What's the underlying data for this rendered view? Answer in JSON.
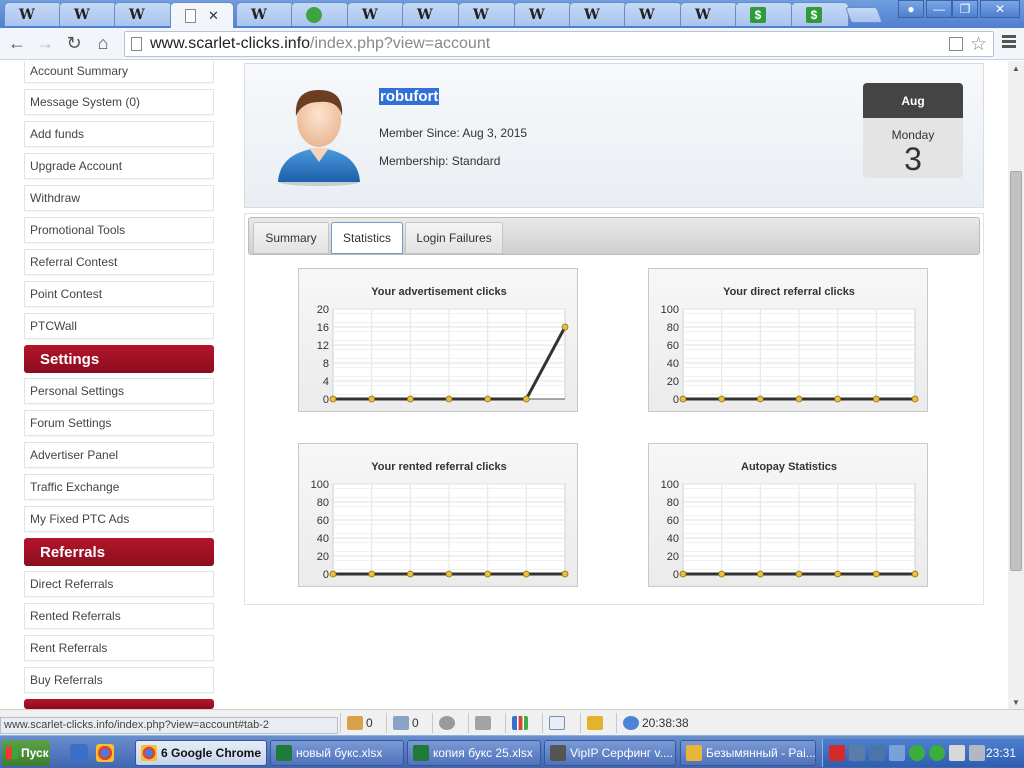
{
  "browser": {
    "tabs": [
      {
        "icon": "wikipedia-icon",
        "label": "W"
      },
      {
        "icon": "wikipedia-icon",
        "label": "W"
      },
      {
        "icon": "wikipedia-icon",
        "label": "W"
      },
      {
        "icon": "page-icon",
        "label": "",
        "active": true
      },
      {
        "icon": "wikipedia-icon",
        "label": "W"
      },
      {
        "icon": "frog-icon",
        "label": ""
      },
      {
        "icon": "wikipedia-icon",
        "label": "W"
      },
      {
        "icon": "wikipedia-icon",
        "label": "W"
      },
      {
        "icon": "wikipedia-icon",
        "label": "W"
      },
      {
        "icon": "wikipedia-icon",
        "label": "W"
      },
      {
        "icon": "wikipedia-icon",
        "label": "W"
      },
      {
        "icon": "wikipedia-icon",
        "label": "W"
      },
      {
        "icon": "wikipedia-icon",
        "label": "W"
      },
      {
        "icon": "dollar-icon",
        "label": "$"
      },
      {
        "icon": "dollar-icon",
        "label": "$"
      }
    ],
    "close_glyph": "✕",
    "url_host": "www.scarlet-clicks.info",
    "url_path": "/index.php?view=account",
    "status_url": "www.scarlet-clicks.info/index.php?view=account#tab-2"
  },
  "sidebar": {
    "group1": [
      "Account Summary",
      "Message System (0)",
      "Add funds",
      "Upgrade Account",
      "Withdraw",
      "Promotional Tools",
      "Referral Contest",
      "Point Contest",
      "PTCWall"
    ],
    "settings_header": "Settings",
    "group2": [
      "Personal Settings",
      "Forum Settings",
      "Advertiser Panel",
      "Traffic Exchange",
      "My Fixed PTC Ads"
    ],
    "referrals_header": "Referrals",
    "group3": [
      "Direct Referrals",
      "Rented Referrals",
      "Rent Referrals",
      "Buy Referrals"
    ]
  },
  "profile": {
    "username": "robufort",
    "member_since": "Member Since: Aug 3, 2015",
    "membership": "Membership: Standard",
    "calendar": {
      "month": "Aug",
      "weekday": "Monday",
      "day": "3"
    }
  },
  "tabs": [
    "Summary",
    "Statistics",
    "Login Failures"
  ],
  "active_tab": "Statistics",
  "chart_data": [
    {
      "type": "line",
      "title": "Your advertisement clicks",
      "ylim": [
        0,
        20
      ],
      "yticks": [
        0,
        4,
        8,
        12,
        16,
        20
      ],
      "values": [
        0,
        0,
        0,
        0,
        0,
        0,
        16
      ],
      "grid": true,
      "line_color": "#333333",
      "point_color": "#e8c23a"
    },
    {
      "type": "line",
      "title": "Your direct referral clicks",
      "ylim": [
        0,
        100
      ],
      "yticks": [
        0,
        20,
        40,
        60,
        80,
        100
      ],
      "values": [
        0,
        0,
        0,
        0,
        0,
        0,
        0
      ],
      "grid": true,
      "line_color": "#333333",
      "point_color": "#e8c23a"
    },
    {
      "type": "line",
      "title": "Your rented referral clicks",
      "ylim": [
        0,
        100
      ],
      "yticks": [
        0,
        20,
        40,
        60,
        80,
        100
      ],
      "values": [
        0,
        0,
        0,
        0,
        0,
        0,
        0
      ],
      "grid": true,
      "line_color": "#333333",
      "point_color": "#e8c23a"
    },
    {
      "type": "line",
      "title": "Autopay Statistics",
      "ylim": [
        0,
        100
      ],
      "yticks": [
        0,
        20,
        40,
        60,
        80,
        100
      ],
      "values": [
        0,
        0,
        0,
        0,
        0,
        0,
        0
      ],
      "grid": true,
      "line_color": "#333333",
      "point_color": "#e8c23a"
    }
  ],
  "statusbar": {
    "count1": "0",
    "count2": "0",
    "timer": "20:38:38"
  },
  "taskbar": {
    "start": "Пуск",
    "buttons": [
      {
        "label": "6 Google Chrome",
        "icon": "chrome-icon",
        "active": true
      },
      {
        "label": "новый букс.xlsx",
        "icon": "excel-icon"
      },
      {
        "label": "копия букс 25.xlsx",
        "icon": "excel-icon"
      },
      {
        "label": "VipIP Серфинг  v....",
        "icon": "vipip-icon"
      },
      {
        "label": "Безымянный - Pai...",
        "icon": "paint-icon"
      }
    ],
    "clock": "23:31"
  },
  "colors": {
    "accent_red": "#a11226",
    "tab_blue": "#6a9bd1",
    "selection": "#3170d8"
  }
}
